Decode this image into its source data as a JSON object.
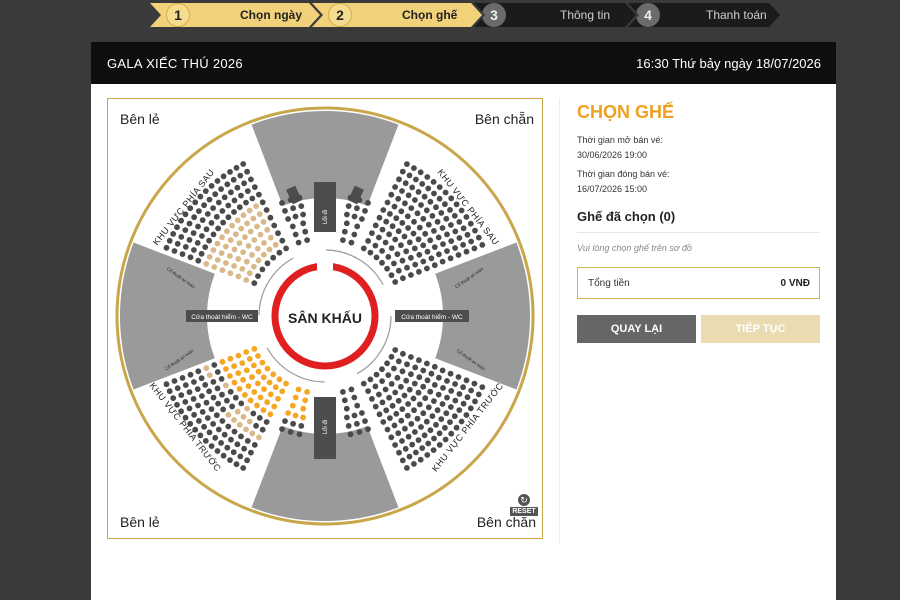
{
  "steps": [
    {
      "num": "1",
      "label": "Chọn ngày",
      "state": "active"
    },
    {
      "num": "2",
      "label": "Chọn ghế",
      "state": "active"
    },
    {
      "num": "3",
      "label": "Thông tin",
      "state": "inactive"
    },
    {
      "num": "4",
      "label": "Thanh toán",
      "state": "inactive"
    }
  ],
  "header": {
    "title": "GALA XIẾC THÚ 2026",
    "datetime": "16:30 Thứ bảy ngày 18/07/2026"
  },
  "map": {
    "corner_tl": "Bên lẻ",
    "corner_tr": "Bên chẵn",
    "corner_bl": "Bên lẻ",
    "corner_br": "Bên chẵn",
    "stage": "SÂN KHẤU",
    "zone_back_left": "KHU VỰC PHÍA SAU",
    "zone_back_right": "KHU VỰC PHÍA SAU",
    "zone_front_left": "KHU VỰC PHÍA TRƯỚC",
    "zone_front_right": "KHU VỰC PHÍA TRƯỚC",
    "exit_left": "Cửa thoát hiểm - WC",
    "exit_right": "Cửa thoát hiểm - WC",
    "aisle_top": "Lối đi",
    "aisle_bottom": "Lối đi",
    "tech_label": "Cổ thuật an toàn",
    "reset_label": "RESET",
    "colors": {
      "occupied": "#4a4a4a",
      "available_gold": "#d9b98a",
      "available_orange": "#f5a623",
      "stage_ring": "#e02020",
      "frame": "#c9a64a"
    }
  },
  "sidebar": {
    "heading": "CHỌN GHẾ",
    "open_label": "Thời gian mở bán vé:",
    "open_value": "30/06/2026 19:00",
    "close_label": "Thời gian đóng bán vé:",
    "close_value": "16/07/2026 15:00",
    "chosen_title": "Ghế đã chọn (0)",
    "hint": "Vui lòng chọn ghế trên sơ đồ",
    "total_label": "Tổng tiền",
    "total_value": "0 VNĐ",
    "back_button": "QUAY LẠI",
    "next_button": "TIẾP TỤC"
  }
}
